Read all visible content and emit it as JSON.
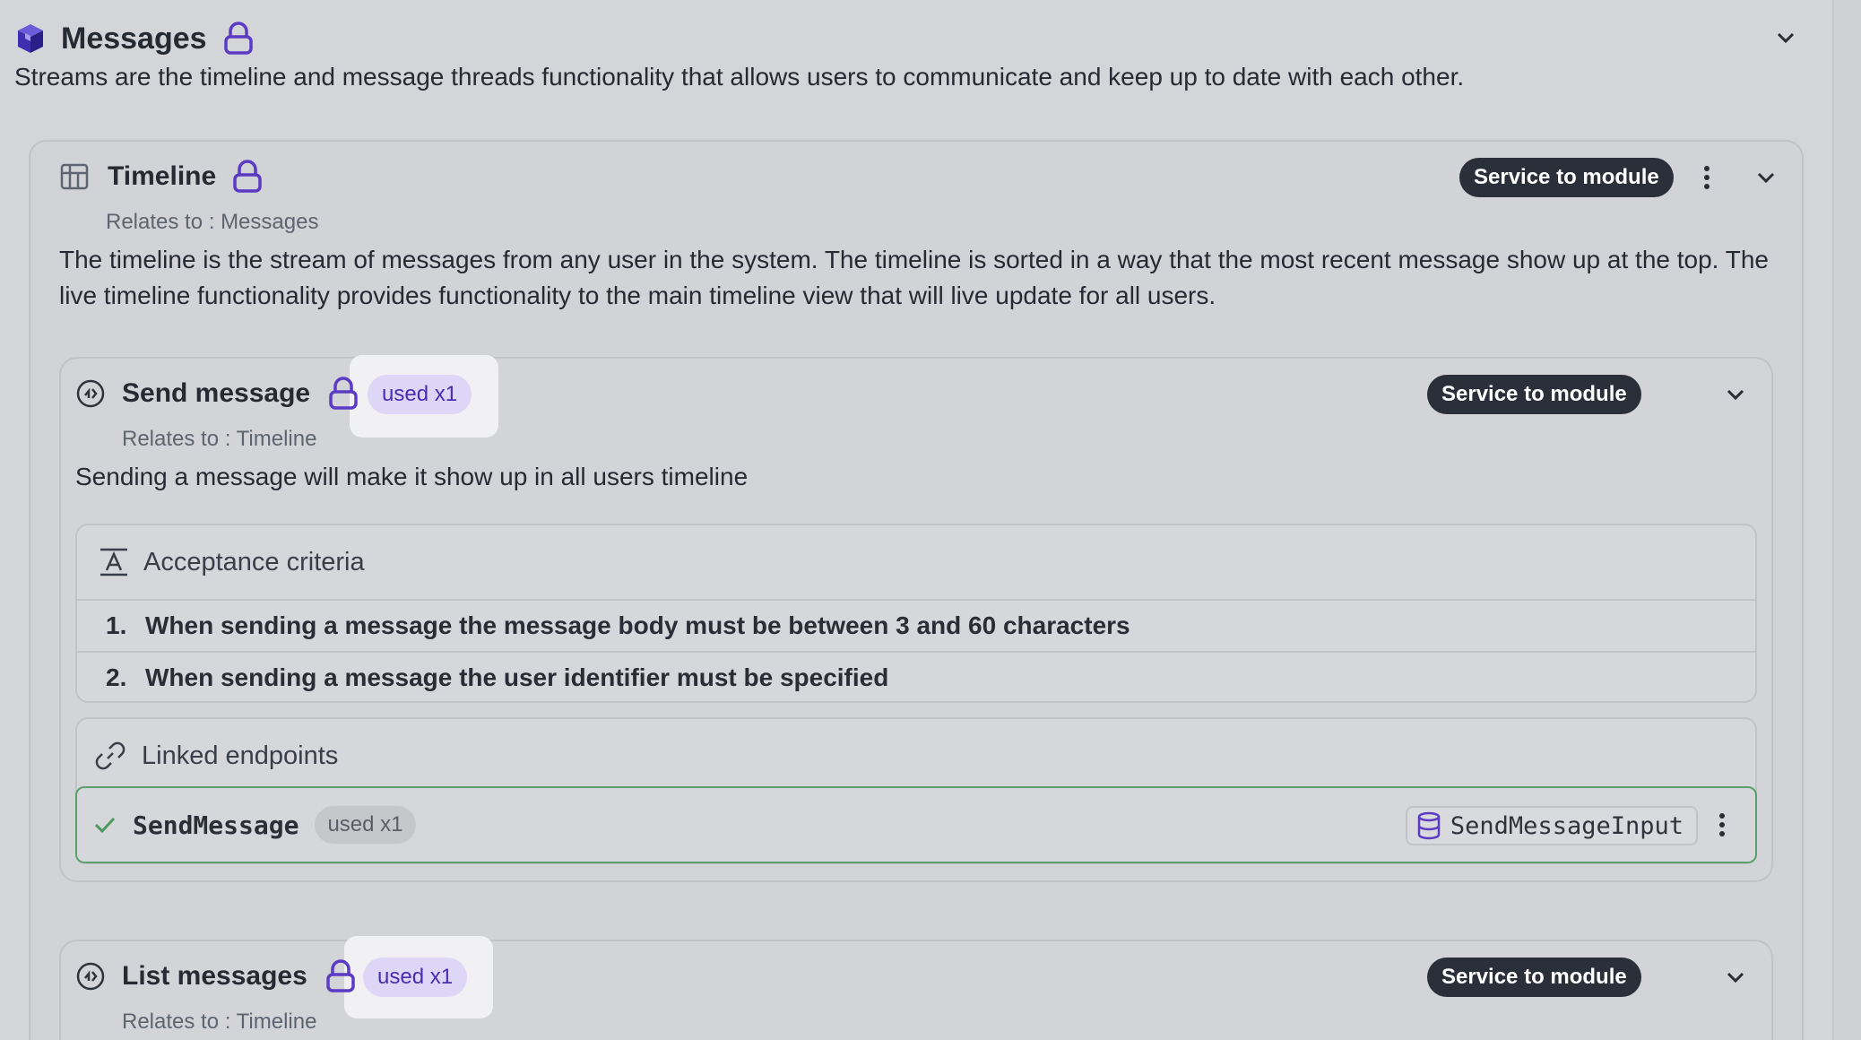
{
  "module": {
    "title": "Messages",
    "description": "Streams are the timeline and message threads functionality that allows users to communicate and keep up to date with each other."
  },
  "timeline": {
    "title": "Timeline",
    "badge": "Service to module",
    "relates": "Relates to : Messages",
    "description": "The timeline is the stream of messages from any user in the system. The timeline is sorted in a way that the most recent message show up at the top. The live timeline functionality provides functionality to the main timeline view that will live update for all users."
  },
  "send_message": {
    "title": "Send message",
    "used": "used x1",
    "badge": "Service to module",
    "relates": "Relates to : Timeline",
    "description": "Sending a message will make it show up in all users timeline",
    "acceptance_title": "Acceptance criteria",
    "criteria": [
      {
        "num": "1.",
        "text": "When sending a message the message body must be between 3 and 60 characters"
      },
      {
        "num": "2.",
        "text": "When sending a message the user identifier must be specified"
      }
    ],
    "linked_title": "Linked endpoints",
    "endpoint": {
      "name": "SendMessage",
      "used": "used x1",
      "input": "SendMessageInput"
    }
  },
  "list_messages": {
    "title": "List messages",
    "used": "used x1",
    "badge": "Service to module",
    "relates": "Relates to : Timeline"
  },
  "colors": {
    "background": "#d4d5d8",
    "accent_purple": "#5b3bc4",
    "badge_dark": "#2a2f3a",
    "success_green": "#5aa06a"
  },
  "icons": [
    "cube-icon",
    "lock-icon",
    "chevron-down-icon",
    "table-icon",
    "kebab-icon",
    "service-icon",
    "text-icon",
    "link-icon",
    "check-icon",
    "database-icon"
  ]
}
